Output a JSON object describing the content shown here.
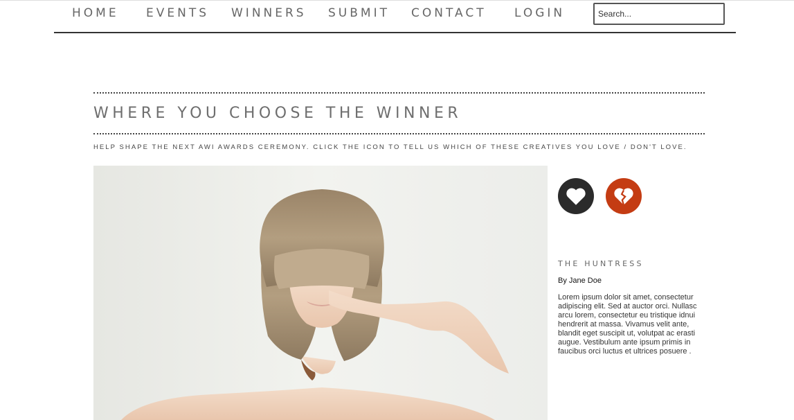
{
  "nav": {
    "items": [
      {
        "label": "HOME"
      },
      {
        "label": "EVENTS"
      },
      {
        "label": "WINNERS"
      },
      {
        "label": "SUBMIT"
      },
      {
        "label": "CONTACT"
      },
      {
        "label": "LOGIN"
      }
    ],
    "search_placeholder": "Search..."
  },
  "page": {
    "title": "WHERE YOU CHOOSE THE WINNER",
    "subtitle": "HELP SHAPE THE NEXT AWI AWARDS CEREMONY. CLICK THE ICON TO TELL US WHICH OF THESE CREATIVES YOU LOVE / DON'T LOVE."
  },
  "vote": {
    "love_icon": "heart-icon",
    "dont_love_icon": "broken-heart-icon",
    "love_color": "#2b2b2b",
    "dont_love_color": "#c43c13"
  },
  "entry": {
    "title": "THE HUNTRESS",
    "author": "By Jane Doe",
    "description": "Lorem ipsum dolor sit amet, consectetur adipiscing elit. Sed at auctor orci. Nullasc arcu lorem, consectetur eu tristique idnui hendrerit at massa. Vivamus velit ante, blandit eget suscipit ut, volutpat ac erasti augue. Vestibulum ante ipsum primis in faucibus orci luctus et ultrices posuere ."
  }
}
